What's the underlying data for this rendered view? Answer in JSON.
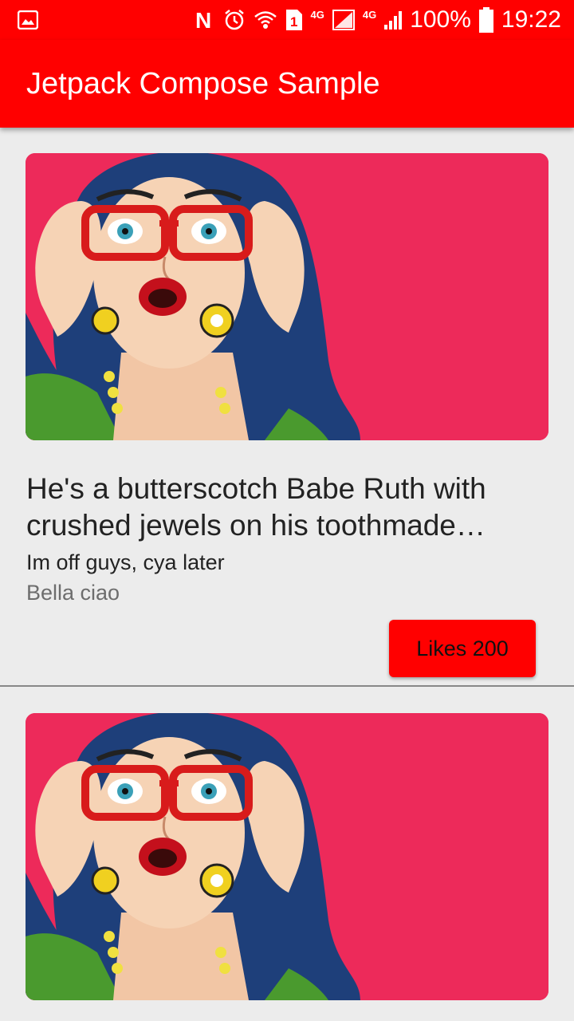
{
  "status_bar": {
    "network_type_1": "4G",
    "network_type_2": "4G",
    "sim_slot": "1",
    "battery": "100%",
    "time": "19:22",
    "icons": [
      "gallery-icon",
      "nfc-icon",
      "alarm-icon",
      "wifi-icon",
      "sim-icon",
      "signal-icon",
      "battery-icon"
    ]
  },
  "app_bar": {
    "title": "Jetpack Compose Sample",
    "color": "#ff0000"
  },
  "cards": [
    {
      "headline": "He's a butterscotch Babe Ruth with crushed jewels on his toothmade…",
      "subtitle": "Im off guys, cya later",
      "author": "Bella ciao",
      "likes_label": "Likes 200",
      "image_background": "#ed2a5a"
    },
    {
      "image_background": "#ed2a5a"
    }
  ]
}
